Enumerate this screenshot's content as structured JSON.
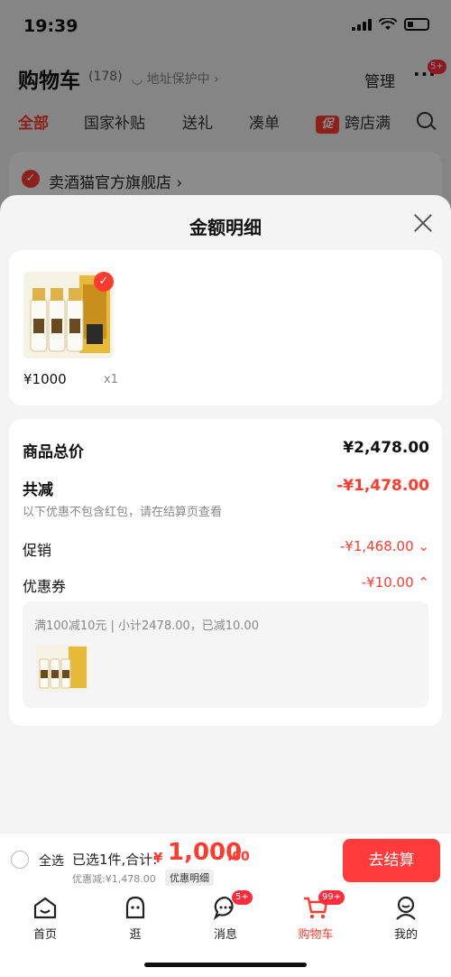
{
  "status": {
    "time": "19:39"
  },
  "nav": {
    "title": "购物车",
    "count": "(178)",
    "address": "地址保护中",
    "manage": "管理",
    "more_badge": "5+"
  },
  "tabs": [
    {
      "label": "全部",
      "active": true
    },
    {
      "label": "国家补贴"
    },
    {
      "label": "送礼"
    },
    {
      "label": "凑单"
    },
    {
      "label": "跨店满",
      "icon_text": "促"
    }
  ],
  "store": {
    "name": "卖酒猫官方旗舰店"
  },
  "sheet": {
    "title": "金额明细",
    "product": {
      "price": "¥1000",
      "qty": "x1"
    },
    "detail": {
      "total_label": "商品总价",
      "total_value": "¥2,478.00",
      "reduce_label": "共减",
      "reduce_value": "-¥1,478.00",
      "reduce_note": "以下优惠不包含红包，请在结算页查看",
      "promo_label": "促销",
      "promo_value": "-¥1,468.00",
      "coupon_label": "优惠券",
      "coupon_value": "-¥10.00",
      "coupon_desc": "满100减10元 | 小计2478.00，已减10.00"
    }
  },
  "checkout": {
    "all_label": "全选",
    "selected_label": "已选1件,合计:",
    "currency": "¥",
    "total_int": "1,000",
    "total_dec": ".00",
    "saved": "优惠减:¥1,478.00",
    "detail_chip": "优惠明细",
    "button": "去结算"
  },
  "tabbar": [
    {
      "label": "首页",
      "icon": "home-icon"
    },
    {
      "label": "逛",
      "icon": "browse-icon"
    },
    {
      "label": "消息",
      "icon": "message-icon",
      "badge": "5+"
    },
    {
      "label": "购物车",
      "icon": "cart-icon",
      "badge": "99+",
      "active": true
    },
    {
      "label": "我的",
      "icon": "profile-icon"
    }
  ],
  "colors": {
    "accent": "#ff3b30",
    "background": "#f4f4f4"
  }
}
